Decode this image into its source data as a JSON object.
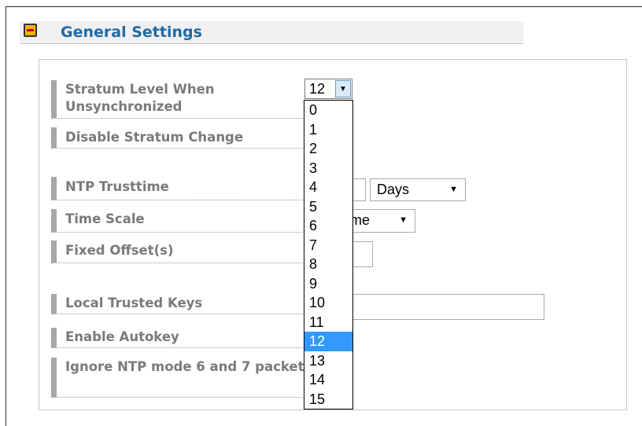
{
  "section": {
    "title": "General Settings",
    "collapse_icon": "minus-icon"
  },
  "fields": {
    "stratum_label": "Stratum Level When Unsynchronized",
    "disable_stratum_label": "Disable Stratum Change",
    "ntp_trusttime_label": "NTP Trusttime",
    "time_scale_label": "Time Scale",
    "fixed_offset_label": "Fixed Offset(s)",
    "local_trusted_keys_label": "Local Trusted Keys",
    "enable_autokey_label": "Enable Autokey",
    "ignore_ntp_label": "Ignore NTP mode 6 and 7 packets"
  },
  "stratum_select": {
    "selected": "12",
    "options": [
      "0",
      "1",
      "2",
      "3",
      "4",
      "5",
      "6",
      "7",
      "8",
      "9",
      "10",
      "11",
      "12",
      "13",
      "14",
      "15"
    ]
  },
  "trusttime_unit": {
    "selected": "Days"
  },
  "time_scale": {
    "selected_visible": "ime"
  },
  "colors": {
    "title": "#1e6aa8",
    "label": "#7a7a7a",
    "label_bar": "#a7a7a7",
    "highlight": "#3399ff"
  }
}
